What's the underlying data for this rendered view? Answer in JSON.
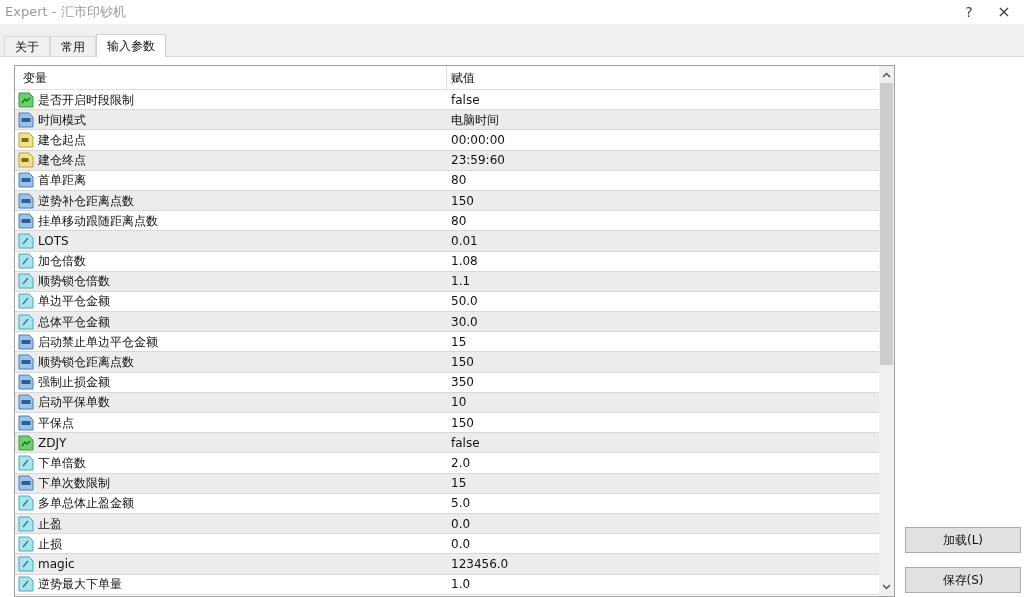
{
  "window": {
    "title": "Expert - 汇市印钞机",
    "help": "?",
    "close": "×"
  },
  "tabs": [
    {
      "label": "关于",
      "selected": false
    },
    {
      "label": "常用",
      "selected": false
    },
    {
      "label": "输入参数",
      "selected": true
    }
  ],
  "table": {
    "columns": [
      "变量",
      "赋值"
    ],
    "rows": [
      {
        "kind": "bool",
        "name": "是否开启时段限制",
        "value": "false"
      },
      {
        "kind": "int",
        "name": "时间模式",
        "value": "电脑时间"
      },
      {
        "kind": "string",
        "name": "建仓起点",
        "value": "00:00:00"
      },
      {
        "kind": "string",
        "name": "建仓终点",
        "value": "23:59:60"
      },
      {
        "kind": "int",
        "name": "首单距离",
        "value": "80"
      },
      {
        "kind": "int",
        "name": "逆势补仓距离点数",
        "value": "150"
      },
      {
        "kind": "int",
        "name": "挂单移动跟随距离点数",
        "value": "80"
      },
      {
        "kind": "double",
        "name": "LOTS",
        "value": "0.01"
      },
      {
        "kind": "double",
        "name": "加仓倍数",
        "value": "1.08"
      },
      {
        "kind": "double",
        "name": "顺势锁仓倍数",
        "value": "1.1"
      },
      {
        "kind": "double",
        "name": "单边平仓金额",
        "value": "50.0"
      },
      {
        "kind": "double",
        "name": "总体平仓金额",
        "value": "30.0"
      },
      {
        "kind": "int",
        "name": "启动禁止单边平仓金额",
        "value": "15"
      },
      {
        "kind": "int",
        "name": "顺势锁仓距离点数",
        "value": "150"
      },
      {
        "kind": "int",
        "name": "强制止损金额",
        "value": "350"
      },
      {
        "kind": "int",
        "name": "启动平保单数",
        "value": "10"
      },
      {
        "kind": "int",
        "name": "平保点",
        "value": "150"
      },
      {
        "kind": "bool",
        "name": "ZDJY",
        "value": "false"
      },
      {
        "kind": "double",
        "name": "下单倍数",
        "value": "2.0"
      },
      {
        "kind": "int",
        "name": "下单次数限制",
        "value": "15"
      },
      {
        "kind": "double",
        "name": "多单总体止盈金额",
        "value": "5.0"
      },
      {
        "kind": "double",
        "name": "止盈",
        "value": "0.0"
      },
      {
        "kind": "double",
        "name": "止损",
        "value": "0.0"
      },
      {
        "kind": "double",
        "name": "magic",
        "value": "123456.0"
      },
      {
        "kind": "double",
        "name": "逆势最大下单量",
        "value": "1.0"
      }
    ]
  },
  "buttons": [
    "加载(L)",
    "保存(S)"
  ]
}
